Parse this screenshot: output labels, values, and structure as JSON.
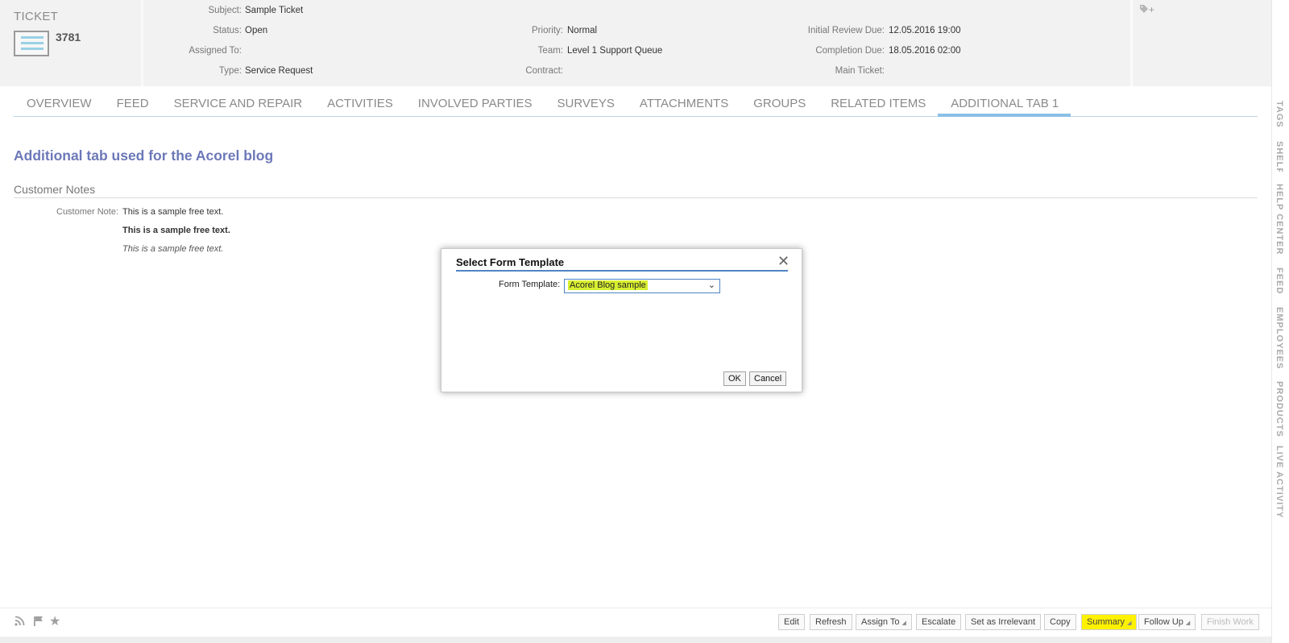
{
  "header": {
    "ticket_label": "TICKET",
    "ticket_number": "3781",
    "subject_label": "Subject:",
    "subject": "Sample Ticket",
    "status_label": "Status:",
    "status": "Open",
    "assigned_label": "Assigned To:",
    "assigned": "",
    "type_label": "Type:",
    "type": "Service Request",
    "priority_label": "Priority:",
    "priority": "Normal",
    "team_label": "Team:",
    "team": "Level 1 Support Queue",
    "contract_label": "Contract:",
    "contract": "",
    "review_label": "Initial Review Due:",
    "review": "12.05.2016 19:00",
    "completion_label": "Completion Due:",
    "completion": "18.05.2016 02:00",
    "main_ticket_label": "Main Ticket:",
    "main_ticket": "",
    "tag_add": "+"
  },
  "tabs": [
    "OVERVIEW",
    "FEED",
    "SERVICE AND REPAIR",
    "ACTIVITIES",
    "INVOLVED PARTIES",
    "SURVEYS",
    "ATTACHMENTS",
    "GROUPS",
    "RELATED ITEMS",
    "ADDITIONAL TAB 1"
  ],
  "active_tab": "ADDITIONAL TAB 1",
  "content": {
    "title": "Additional tab used for the Acorel blog",
    "section": "Customer Notes",
    "note_label": "Customer Note:",
    "note_plain": "This is a sample free text.",
    "note_bold": "This is a sample free text.",
    "note_italic": "This is a sample free text."
  },
  "dialog": {
    "title": "Select Form Template",
    "field_label": "Form Template:",
    "selected": "Acorel Blog sample",
    "ok": "OK",
    "cancel": "Cancel"
  },
  "footer": {
    "buttons": [
      "Edit",
      "Refresh",
      "Assign To",
      "Escalate",
      "Set as Irrelevant",
      "Copy",
      "Summary",
      "Follow Up",
      "Finish Work"
    ],
    "highlighted": "Summary",
    "disabled": "Finish Work"
  },
  "sidebar": [
    "TAGS",
    "SHELF",
    "HELP CENTER",
    "FEED",
    "EMPLOYEES",
    "PRODUCTS",
    "LIVE ACTIVITY"
  ],
  "colors": {
    "tab_active": "#8bbfe6",
    "title": "#6c78b8",
    "highlight": "#fff200",
    "dialog_accent": "#4f84c2"
  }
}
